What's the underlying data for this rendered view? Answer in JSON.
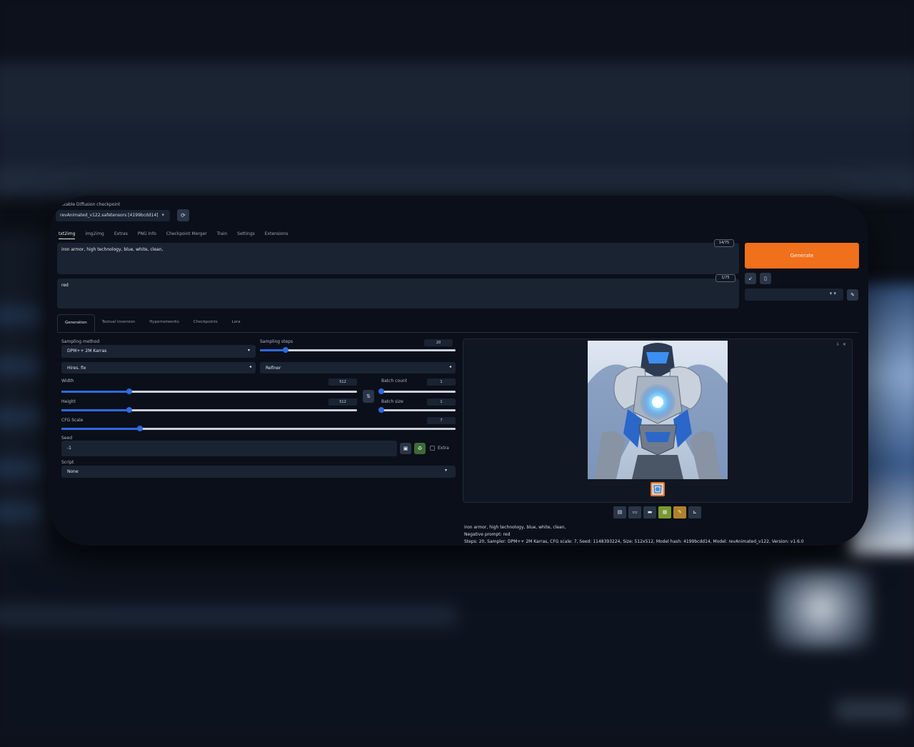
{
  "checkpoint": {
    "label": "Stable Diffusion checkpoint",
    "value": "revAnimated_v122.safetensors [4199bcdd14]",
    "refresh_icon": "refresh-icon"
  },
  "tabs": [
    "txt2img",
    "img2img",
    "Extras",
    "PNG Info",
    "Checkpoint Merger",
    "Train",
    "Settings",
    "Extensions"
  ],
  "prompt": {
    "value": "iron armor, high technology, blue, white, clean,",
    "counter": "14/75"
  },
  "negative_prompt": {
    "value": "red",
    "counter": "1/75"
  },
  "generate": {
    "label": "Generate"
  },
  "styles": {
    "value": ""
  },
  "subtabs": [
    "Generation",
    "Textual Inversion",
    "Hypernetworks",
    "Checkpoints",
    "Lora"
  ],
  "params": {
    "sampling_method": {
      "label": "Sampling method",
      "value": "DPM++ 2M Karras"
    },
    "sampling_steps": {
      "label": "Sampling steps",
      "value": "20",
      "fraction": 0.13
    },
    "hires_fix": {
      "label": "Hires. fix"
    },
    "refiner": {
      "label": "Refiner"
    },
    "width": {
      "label": "Width",
      "value": "512",
      "fraction": 0.23
    },
    "height": {
      "label": "Height",
      "value": "512",
      "fraction": 0.23
    },
    "batch_count": {
      "label": "Batch count",
      "value": "1",
      "fraction": 0.0
    },
    "batch_size": {
      "label": "Batch size",
      "value": "1",
      "fraction": 0.0
    },
    "cfg_scale": {
      "label": "CFG Scale",
      "value": "7",
      "fraction": 0.2
    },
    "seed": {
      "label": "Seed",
      "value": "-1"
    },
    "extra": {
      "label": "Extra"
    },
    "script": {
      "label": "Script",
      "value": "None"
    }
  },
  "output": {
    "info_lines": [
      "iron armor, high technology, blue, white, clean,",
      "Negative prompt: red",
      "Steps: 20, Sampler: DPM++ 2M Karras, CFG scale: 7, Seed: 1148393224, Size: 512x512, Model hash: 4199bcdd14, Model: revAnimated_v122, Version: v1.6.0"
    ]
  },
  "colors": {
    "accent": "#f0701c",
    "slider": "#2d6be0",
    "background": "#0b0f19"
  }
}
